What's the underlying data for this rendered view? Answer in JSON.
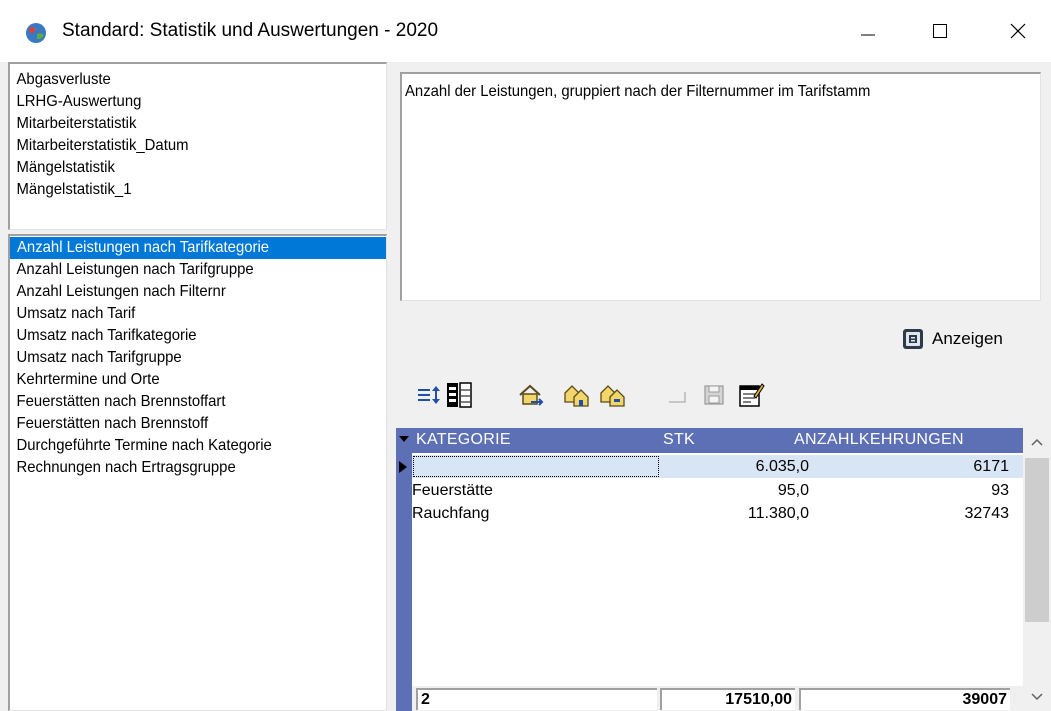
{
  "window": {
    "title": "Standard: Statistik und Auswertungen - 2020",
    "app_icon": "app-globe-icon",
    "controls": [
      "minimize-icon",
      "maximize-icon",
      "close-icon"
    ]
  },
  "top_list": {
    "items": [
      {
        "label": "Abgasverluste"
      },
      {
        "label": "LRHG-Auswertung"
      },
      {
        "label": "Mitarbeiterstatistik"
      },
      {
        "label": "Mitarbeiterstatistik_Datum"
      },
      {
        "label": "Mängelstatistik"
      },
      {
        "label": "Mängelstatistik_1"
      }
    ]
  },
  "bottom_list": {
    "selected_index": 0,
    "items": [
      {
        "label": "Anzahl Leistungen nach Tarifkategorie"
      },
      {
        "label": "Anzahl Leistungen nach Tarifgruppe"
      },
      {
        "label": "Anzahl Leistungen nach Filternr"
      },
      {
        "label": "Umsatz nach Tarif"
      },
      {
        "label": "Umsatz nach Tarifkategorie"
      },
      {
        "label": "Umsatz nach Tarifgruppe"
      },
      {
        "label": "Kehrtermine und Orte"
      },
      {
        "label": "Feuerstätten nach Brennstoffart"
      },
      {
        "label": "Feuerstätten nach Brennstoff"
      },
      {
        "label": "Durchgeführte Termine nach Kategorie"
      },
      {
        "label": "Rechnungen nach Ertragsgruppe"
      }
    ]
  },
  "description": {
    "text": "Anzahl der Leistungen, gruppiert nach der Filternummer im Tarifstamm"
  },
  "anzeigen_button": {
    "label": "Anzeigen",
    "icon": "display-icon"
  },
  "toolbar": {
    "icons": [
      "sort-icon",
      "columns-icon",
      "house-arrow-icon",
      "houses-icon",
      "houses-alt-icon",
      "blank-icon",
      "save-icon",
      "edit-report-icon"
    ]
  },
  "grid": {
    "columns": [
      "KATEGORIE",
      "STK",
      "ANZAHLKEHRUNGEN"
    ],
    "current_row": 0,
    "rows": [
      {
        "kategorie": "",
        "stk": "6.035,0",
        "anzahl": "6171"
      },
      {
        "kategorie": "Feuerstätte",
        "stk": "95,0",
        "anzahl": "93"
      },
      {
        "kategorie": "Rauchfang",
        "stk": "11.380,0",
        "anzahl": "32743"
      }
    ],
    "footer": {
      "count": "2",
      "stk_total": "17510,00",
      "anzahl_total": "39007"
    }
  },
  "colors": {
    "selection": "#0078d7",
    "grid_header": "#5d6fb5",
    "current_row": "#d8e5f4"
  }
}
